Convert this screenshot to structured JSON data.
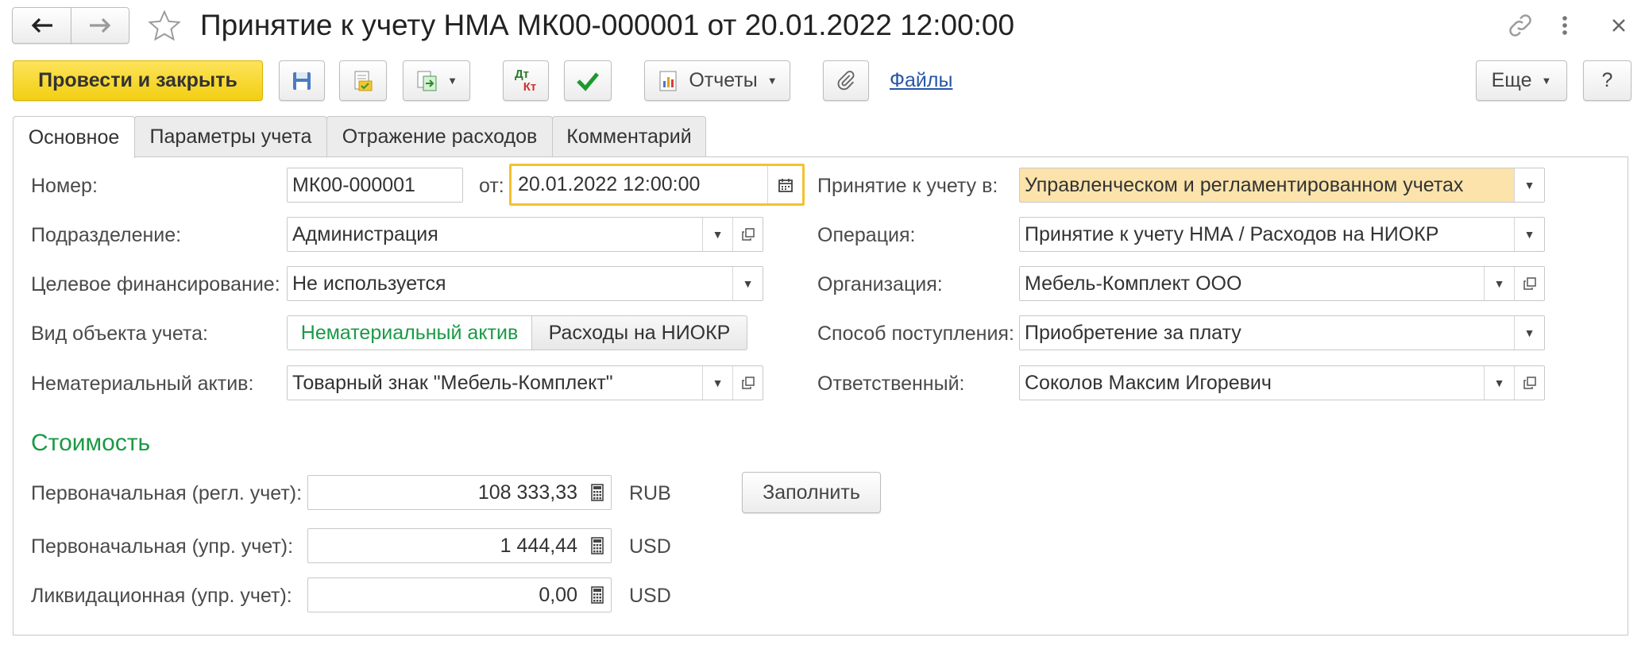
{
  "window": {
    "title": "Принятие к учету НМА МК00-000001 от 20.01.2022 12:00:00"
  },
  "toolbar": {
    "post_close": "Провести и закрыть",
    "reports": "Отчеты",
    "files": "Файлы",
    "more": "Еще",
    "help": "?",
    "dtkt_top": "Дт",
    "dtkt_bottom": "Кт"
  },
  "tabs": [
    "Основное",
    "Параметры учета",
    "Отражение расходов",
    "Комментарий"
  ],
  "form": {
    "number_label": "Номер:",
    "number_value": "МК00-000001",
    "date_label": "от:",
    "date_value": "20.01.2022 12:00:00",
    "accounting_in_label": "Принятие к учету в:",
    "accounting_in_value": "Управленческом и регламентированном учетах",
    "division_label": "Подразделение:",
    "division_value": "Администрация",
    "operation_label": "Операция:",
    "operation_value": "Принятие к учету НМА / Расходов на НИОКР",
    "target_fin_label": "Целевое финансирование:",
    "target_fin_value": "Не используется",
    "org_label": "Организация:",
    "org_value": "Мебель-Комплект ООО",
    "object_kind_label": "Вид объекта учета:",
    "object_kind_options": [
      "Нематериальный актив",
      "Расходы на НИОКР"
    ],
    "receipt_label": "Способ поступления:",
    "receipt_value": "Приобретение за плату",
    "asset_label": "Нематериальный актив:",
    "asset_value": "Товарный знак \"Мебель-Комплект\"",
    "responsible_label": "Ответственный:",
    "responsible_value": "Соколов Максим Игоревич"
  },
  "cost": {
    "heading": "Стоимость",
    "initial_reg_label": "Первоначальная (регл. учет):",
    "initial_reg_value": "108 333,33",
    "initial_reg_currency": "RUB",
    "initial_mgmt_label": "Первоначальная (упр. учет):",
    "initial_mgmt_value": "1 444,44",
    "initial_mgmt_currency": "USD",
    "liquidation_label": "Ликвидационная (упр. учет):",
    "liquidation_value": "0,00",
    "liquidation_currency": "USD",
    "fill_button": "Заполнить"
  },
  "colors": {
    "primary_button": "#f7d51e",
    "green_accent": "#1a9a45",
    "highlight_field": "#fbe3ab",
    "focus_border": "#f2c230"
  }
}
